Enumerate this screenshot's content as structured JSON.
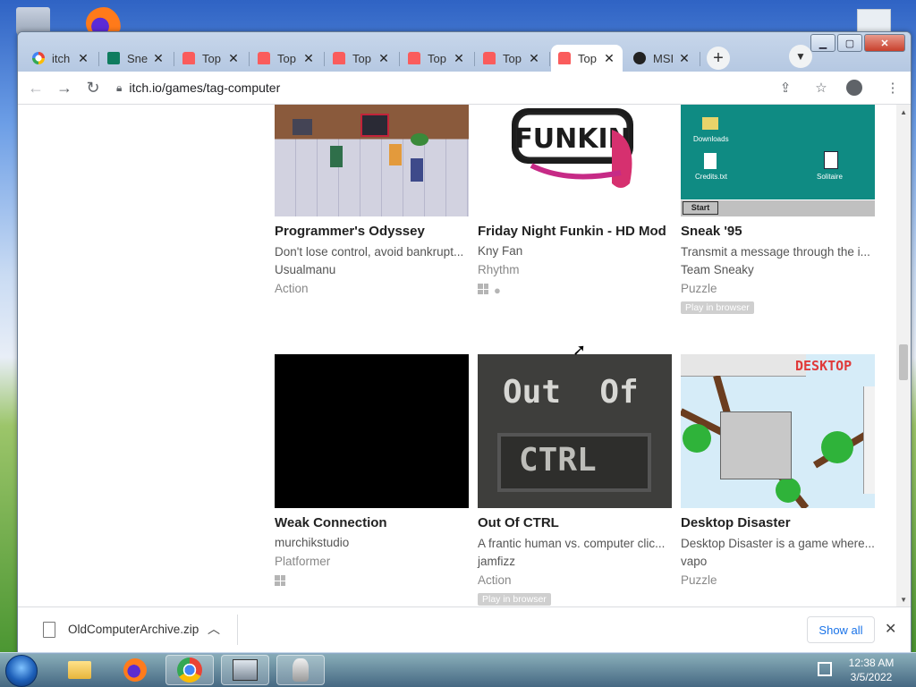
{
  "browser": {
    "tabs": [
      {
        "title": "itch",
        "favicon": "google-icon"
      },
      {
        "title": "Sne",
        "favicon": "sheets-icon"
      },
      {
        "title": "Top",
        "favicon": "itch-icon"
      },
      {
        "title": "Top",
        "favicon": "itch-icon"
      },
      {
        "title": "Top",
        "favicon": "itch-icon"
      },
      {
        "title": "Top",
        "favicon": "itch-icon"
      },
      {
        "title": "Top",
        "favicon": "itch-icon"
      },
      {
        "title": "Top",
        "favicon": "itch-icon",
        "active": true
      },
      {
        "title": "MSI",
        "favicon": "ms-icon"
      }
    ],
    "new_tab_label": "+",
    "url": "itch.io/games/tag-computer"
  },
  "games": [
    {
      "title": "Programmer's Odyssey",
      "desc": "Don't lose control, avoid bankrupt...",
      "author": "Usualmanu",
      "genre": "Action"
    },
    {
      "title": "Friday Night Funkin - HD Mod",
      "desc": "",
      "author": "Kny Fan",
      "genre": "Rhythm"
    },
    {
      "title": "Sneak '95",
      "desc": "Transmit a message through the i...",
      "author": "Team Sneaky",
      "genre": "Puzzle",
      "badge": "Play in browser"
    },
    {
      "title": "Weak Connection",
      "desc": "",
      "author": "murchikstudio",
      "genre": "Platformer"
    },
    {
      "title": "Out Of CTRL",
      "desc": "A frantic human vs. computer clic...",
      "author": "jamfizz",
      "genre": "Action",
      "badge": "Play in browser"
    },
    {
      "title": "Desktop Disaster",
      "desc": "Desktop Disaster is a game where...",
      "author": "vapo",
      "genre": "Puzzle"
    }
  ],
  "thumb_text": {
    "sneak_downloads": "Downloads",
    "sneak_credits": "Credits.txt",
    "sneak_solitaire": "Solitaire",
    "sneak_start": "Start",
    "ooc_line1": "Out  Of",
    "ooc_line2": "CTRL",
    "dd_logo": "DESKTOP"
  },
  "download": {
    "filename": "OldComputerArchive.zip",
    "show_all": "Show all"
  },
  "clock": {
    "time": "12:38 AM",
    "date": "3/5/2022"
  }
}
